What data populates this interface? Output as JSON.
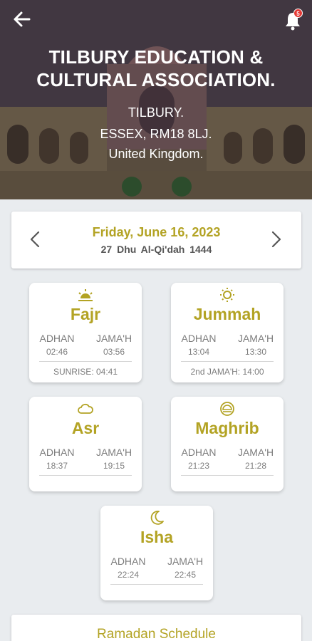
{
  "header": {
    "org_name_line1": "TILBURY EDUCATION &",
    "org_name_line2": "CULTURAL ASSOCIATION.",
    "address_line1": "TILBURY.",
    "address_line2": "ESSEX, RM18 8LJ.",
    "address_line3": "United Kingdom.",
    "notification_count": "5",
    "back_icon": "arrow-left-icon",
    "bell_icon": "bell-icon"
  },
  "date": {
    "gregorian": "Friday, June 16, 2023",
    "hijri": "27  Dhu Al-Qi'dah  1444",
    "prev_icon": "chevron-left-icon",
    "next_icon": "chevron-right-icon"
  },
  "prayers": [
    {
      "name": "Fajr",
      "icon": "sunrise-icon",
      "adhan_label": "ADHAN",
      "jamah_label": "JAMA'H",
      "adhan": "02:46",
      "jamah": "03:56",
      "extra": "SUNRISE: 04:41"
    },
    {
      "name": "Jummah",
      "icon": "sun-icon",
      "adhan_label": "ADHAN",
      "jamah_label": "JAMA'H",
      "adhan": "13:04",
      "jamah": "13:30",
      "extra": "2nd JAMA'H: 14:00"
    },
    {
      "name": "Asr",
      "icon": "cloud-icon",
      "adhan_label": "ADHAN",
      "jamah_label": "JAMA'H",
      "adhan": "18:37",
      "jamah": "19:15"
    },
    {
      "name": "Maghrib",
      "icon": "sunset-icon",
      "adhan_label": "ADHAN",
      "jamah_label": "JAMA'H",
      "adhan": "21:23",
      "jamah": "21:28"
    },
    {
      "name": "Isha",
      "icon": "moon-icon",
      "adhan_label": "ADHAN",
      "jamah_label": "JAMA'H",
      "adhan": "22:24",
      "jamah": "22:45"
    }
  ],
  "ramadan_label": "Ramadan Schedule",
  "colors": {
    "accent": "#b3a324",
    "text_muted": "#7d7d7d",
    "background": "#e9ecef",
    "badge": "#e53935"
  }
}
